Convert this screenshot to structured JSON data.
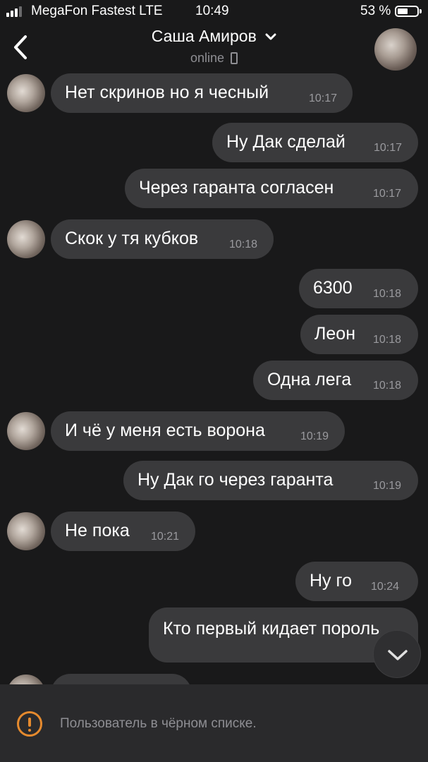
{
  "status_bar": {
    "carrier": "MegaFon Fastest LTE",
    "time": "10:49",
    "battery_percent": "53 %",
    "battery_level": 0.53,
    "signal_bars": 3
  },
  "header": {
    "back_icon": "chevron-left-icon",
    "contact_name": "Саша Амиров",
    "presence": "online",
    "presence_icon": "phone-icon",
    "dropdown_icon": "chevron-down-icon"
  },
  "messages": [
    {
      "from": "them",
      "text": "Нет скринов но я чесный",
      "time": "10:17"
    },
    {
      "from": "me",
      "text": "Ну Дак сделай",
      "time": "10:17"
    },
    {
      "from": "me",
      "text": "Через гаранта согласен",
      "time": "10:17"
    },
    {
      "from": "them",
      "text": "Скок у тя кубков",
      "time": "10:18"
    },
    {
      "from": "me",
      "text": "6300",
      "time": "10:18"
    },
    {
      "from": "me",
      "text": "Леон",
      "time": "10:18"
    },
    {
      "from": "me",
      "text": "Одна лега",
      "time": "10:18"
    },
    {
      "from": "them",
      "text": "И чё у меня есть ворона",
      "time": "10:19"
    },
    {
      "from": "me",
      "text": "Ну Дак го через гаранта",
      "time": "10:19"
    },
    {
      "from": "them",
      "text": "Не пока",
      "time": "10:21"
    },
    {
      "from": "me",
      "text": "Ну го",
      "time": "10:24"
    },
    {
      "from": "me",
      "text": "Кто первый кидает пороль",
      "time": ""
    },
    {
      "from": "them",
      "text": "",
      "time": ""
    }
  ],
  "scroll_button": {
    "icon": "chevron-down-icon"
  },
  "footer": {
    "icon": "warning-icon",
    "text": "Пользователь в чёрном списке.",
    "colors": {
      "warning": "#e58a2e"
    }
  },
  "colors": {
    "background": "#19191a",
    "bubble": "#3a3a3c",
    "secondary_text": "#8e8e93"
  }
}
